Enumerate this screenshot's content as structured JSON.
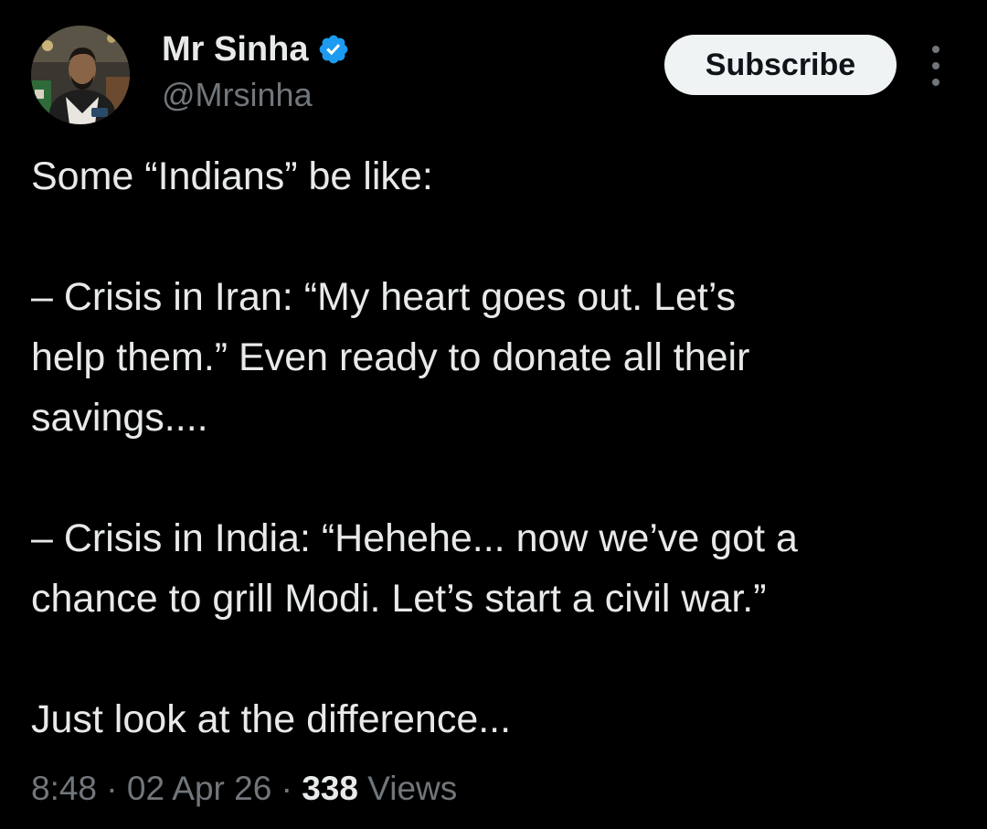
{
  "author": {
    "display_name": "Mr Sinha",
    "handle": "@Mrsinha",
    "verified": true,
    "verified_color": "#1d9bf0"
  },
  "actions": {
    "subscribe_label": "Subscribe",
    "more_icon": "more-vertical-icon"
  },
  "tweet": {
    "lines": [
      "Some “Indians” be like:",
      "",
      "– Crisis in Iran: “My heart goes out. Let’s",
      "help them.” Even ready to donate all their",
      "savings....",
      "",
      "– Crisis in India: “Hehehe... now we’ve got a",
      "chance to grill Modi. Let’s start a civil war.”",
      "",
      "Just look at the difference..."
    ]
  },
  "meta": {
    "time": "8:48",
    "separator": " · ",
    "date": "02 Apr 26",
    "views_count": "338",
    "views_label": " Views"
  },
  "colors": {
    "background": "#000000",
    "primary_text": "#e7e9ea",
    "secondary_text": "#71767b",
    "button_bg": "#eff3f4"
  }
}
